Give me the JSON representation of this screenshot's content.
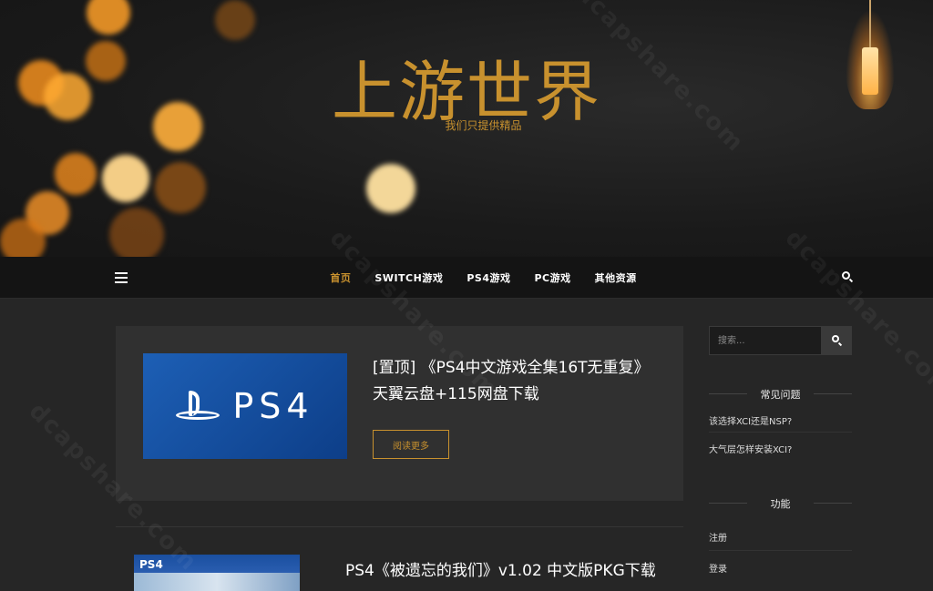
{
  "header": {
    "title": "上游世界",
    "tagline": "我们只提供精品"
  },
  "nav": {
    "items": [
      {
        "label": "首页",
        "active": true
      },
      {
        "label": "SWITCH游戏",
        "active": false
      },
      {
        "label": "PS4游戏",
        "active": false
      },
      {
        "label": "PC游戏",
        "active": false
      },
      {
        "label": "其他资源",
        "active": false
      }
    ]
  },
  "posts": [
    {
      "thumb_text": "PS4",
      "title": "[置顶] 《PS4中文游戏全集16T无重复》 天翼云盘+115网盘下载",
      "read_more": "阅读更多"
    },
    {
      "thumb_text": "PS4",
      "title": "PS4《被遗忘的我们》v1.02 中文版PKG下载"
    }
  ],
  "sidebar": {
    "search_placeholder": "搜索...",
    "faq_title": "常见问题",
    "faq_links": [
      "该选择XCI还是NSP?",
      "大气层怎样安装XCI?"
    ],
    "func_title": "功能",
    "func_links": [
      "注册",
      "登录"
    ]
  },
  "watermark": "dcapshare.com",
  "colors": {
    "accent": "#c8912e",
    "nav_bg": "#141414",
    "page_bg": "#262626",
    "card_bg": "#303030"
  }
}
